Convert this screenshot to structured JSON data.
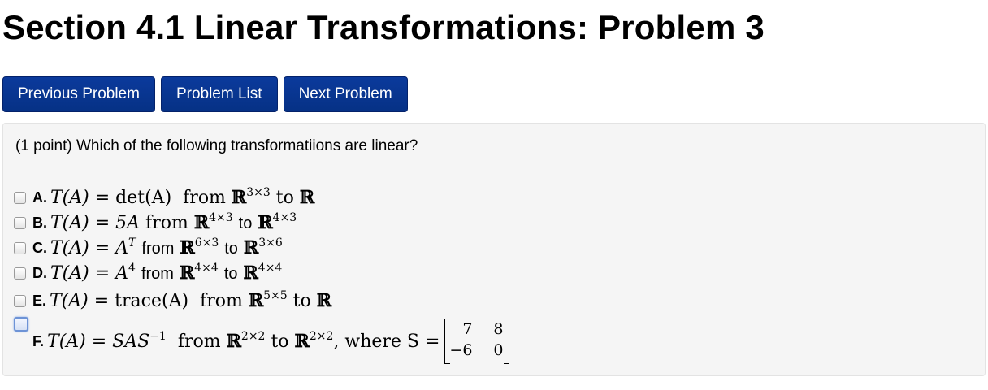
{
  "page": {
    "title": "Section 4.1 Linear Transformations: Problem 3"
  },
  "nav": {
    "previous": "Previous Problem",
    "list": "Problem List",
    "next": "Next Problem"
  },
  "problem": {
    "question": "(1 point) Which of the following transformatiions are linear?",
    "choices": [
      {
        "letter": "A.",
        "lhs": "T(A) = ",
        "rhs": "det(A)",
        "from_word": "from",
        "from_space": "ℝ",
        "from_dim": "3×3",
        "to_word": "to",
        "to_space": "ℝ",
        "to_dim": "",
        "checked": false
      },
      {
        "letter": "B.",
        "lhs": "T(A) = ",
        "rhs": "5A",
        "from_word": "from",
        "from_space": "ℝ",
        "from_dim": "4×3",
        "to_word": "to",
        "to_space": "ℝ",
        "to_dim": "4×3",
        "checked": false
      },
      {
        "letter": "C.",
        "lhs": "T(A) = ",
        "rhs": "A",
        "rhs_sup": "T",
        "from_word": "from",
        "from_space": "ℝ",
        "from_dim": "6×3",
        "to_word": "to",
        "to_space": "ℝ",
        "to_dim": "3×6",
        "checked": false
      },
      {
        "letter": "D.",
        "lhs": "T(A) = ",
        "rhs": "A",
        "rhs_sup": "4",
        "from_word": "from",
        "from_space": "ℝ",
        "from_dim": "4×4",
        "to_word": "to",
        "to_space": "ℝ",
        "to_dim": "4×4",
        "checked": false
      },
      {
        "letter": "E.",
        "lhs": "T(A) = ",
        "rhs": "trace(A)",
        "from_word": "from",
        "from_space": "ℝ",
        "from_dim": "5×5",
        "to_word": "to",
        "to_space": "ℝ",
        "to_dim": "",
        "checked": false
      },
      {
        "letter": "F.",
        "lhs": "T(A) = ",
        "rhs": "SAS",
        "rhs_sup": "−1",
        "from_word": "from",
        "from_space": "ℝ",
        "from_dim": "2×2",
        "to_word": "to",
        "to_space": "ℝ",
        "to_dim": "2×2",
        "where_text": ", where S =",
        "matrix": [
          [
            "7",
            "8"
          ],
          [
            "−6",
            "0"
          ]
        ],
        "checked": false
      }
    ]
  }
}
